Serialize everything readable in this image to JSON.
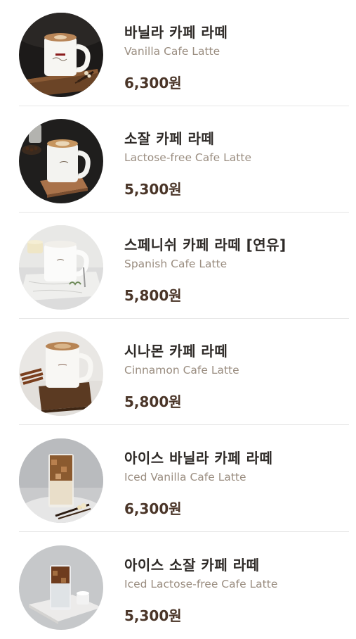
{
  "menu": {
    "items": [
      {
        "name_ko": "바닐라 카페 라떼",
        "name_en": "Vanilla Cafe Latte",
        "price": "6,300원"
      },
      {
        "name_ko": "소잘 카페 라떼",
        "name_en": "Lactose-free Cafe Latte",
        "price": "5,300원"
      },
      {
        "name_ko": "스페니쉬 카페 라떼 [연유]",
        "name_en": "Spanish Cafe Latte",
        "price": "5,800원"
      },
      {
        "name_ko": "시나몬 카페 라떼",
        "name_en": "Cinnamon Cafe Latte",
        "price": "5,800원"
      },
      {
        "name_ko": "아이스 바닐라 카페 라떼",
        "name_en": "Iced Vanilla Cafe Latte",
        "price": "6,300원"
      },
      {
        "name_ko": "아이스 소잘 카페 라떼",
        "name_en": "Iced Lactose-free Cafe Latte",
        "price": "5,300원"
      }
    ]
  },
  "colors": {
    "name_ko": "#2e2a27",
    "name_en": "#9a8d80",
    "price": "#4a3528",
    "divider": "#e6e6e6"
  }
}
